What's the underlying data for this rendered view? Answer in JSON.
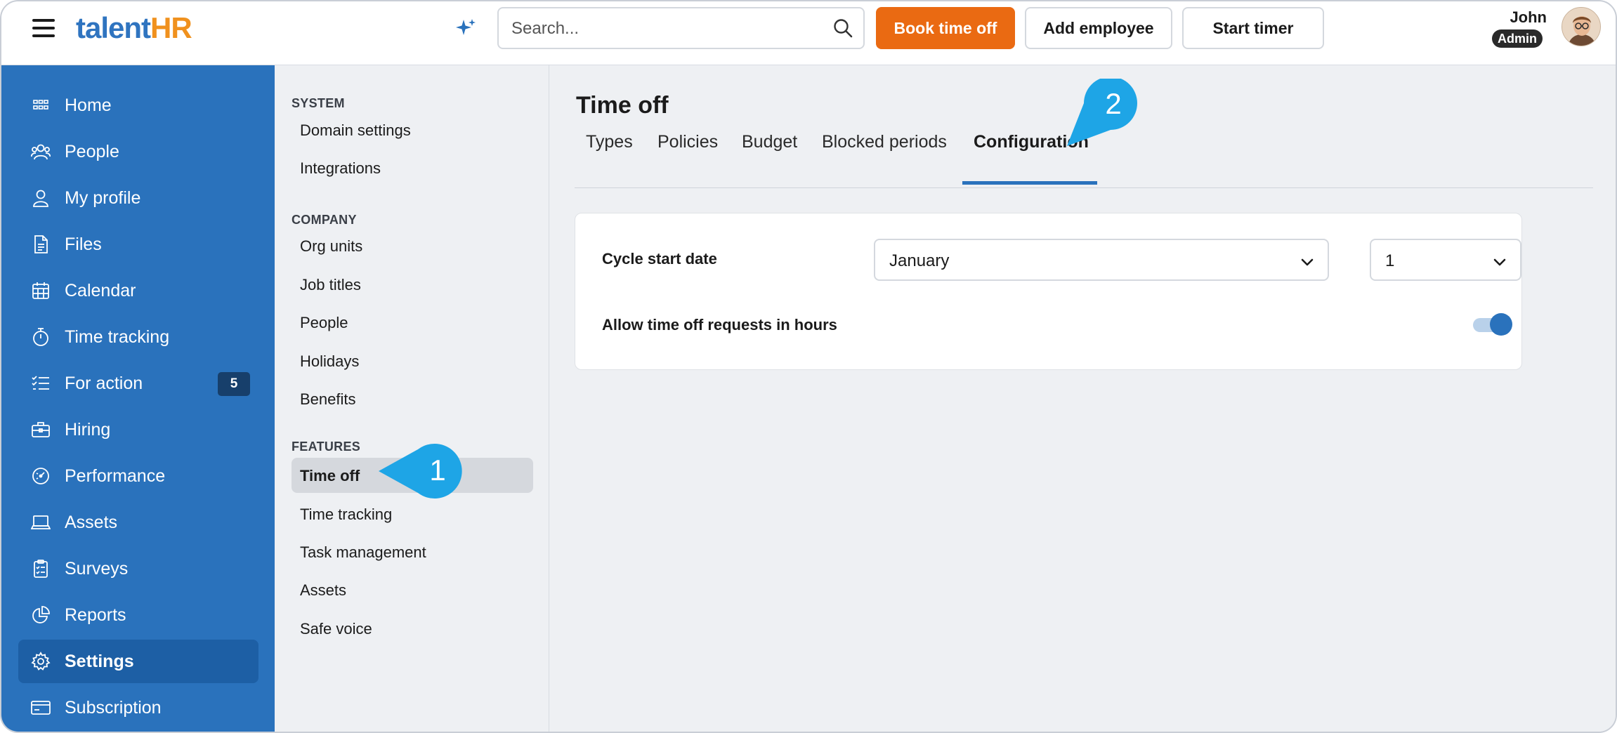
{
  "app": {
    "logo_main": "talent",
    "logo_accent": "HR"
  },
  "header": {
    "search_placeholder": "Search...",
    "book_time_off": "Book time off",
    "add_employee": "Add employee",
    "start_timer": "Start timer",
    "user_name": "John",
    "user_role": "Admin"
  },
  "colors": {
    "brand_blue": "#2a72bc",
    "brand_orange": "#ea6a12",
    "callout": "#1ea5e6"
  },
  "sidebar": {
    "items": [
      {
        "label": "Home",
        "icon": "grid-icon"
      },
      {
        "label": "People",
        "icon": "people-icon"
      },
      {
        "label": "My profile",
        "icon": "user-icon"
      },
      {
        "label": "Files",
        "icon": "file-icon"
      },
      {
        "label": "Calendar",
        "icon": "calendar-icon"
      },
      {
        "label": "Time tracking",
        "icon": "stopwatch-icon"
      },
      {
        "label": "For action",
        "icon": "checklist-icon",
        "badge": "5"
      },
      {
        "label": "Hiring",
        "icon": "briefcase-icon"
      },
      {
        "label": "Performance",
        "icon": "gauge-icon"
      },
      {
        "label": "Assets",
        "icon": "laptop-icon"
      },
      {
        "label": "Surveys",
        "icon": "clipboard-icon"
      },
      {
        "label": "Reports",
        "icon": "pie-chart-icon"
      },
      {
        "label": "Settings",
        "icon": "gear-icon",
        "active": true
      },
      {
        "label": "Subscription",
        "icon": "credit-card-icon"
      }
    ]
  },
  "submenu": {
    "system_heading": "SYSTEM",
    "system_items": [
      "Domain settings",
      "Integrations"
    ],
    "company_heading": "COMPANY",
    "company_items": [
      "Org units",
      "Job titles",
      "People",
      "Holidays",
      "Benefits"
    ],
    "features_heading": "FEATURES",
    "features_items": [
      "Time off",
      "Time tracking",
      "Task management",
      "Assets",
      "Safe voice"
    ],
    "active": "Time off"
  },
  "main": {
    "title": "Time off",
    "tabs": [
      "Types",
      "Policies",
      "Budget",
      "Blocked periods",
      "Configuration"
    ],
    "active_tab": "Configuration",
    "cycle_label": "Cycle start date",
    "cycle_month": "January",
    "cycle_day": "1",
    "hours_label": "Allow time off requests in hours",
    "hours_enabled": true
  },
  "callouts": {
    "step1": "1",
    "step2": "2"
  }
}
